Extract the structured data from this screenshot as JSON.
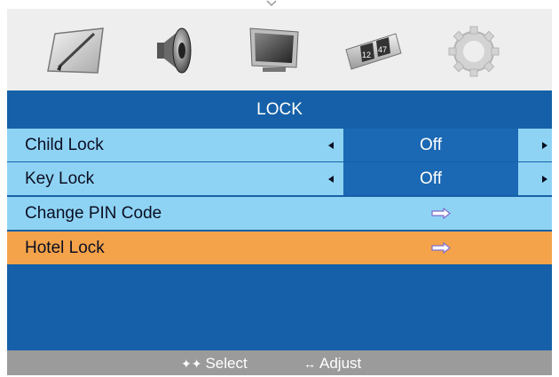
{
  "icons": [
    "picture-icon",
    "sound-icon",
    "screen-icon",
    "clock-icon",
    "settings-gear-icon"
  ],
  "clock_icon_text": {
    "hour": "12",
    "minute": "47"
  },
  "menu": {
    "title": "LOCK",
    "rows": [
      {
        "label": "Child Lock",
        "value": "Off"
      },
      {
        "label": "Key Lock",
        "value": "Off"
      },
      {
        "label": "Change PIN Code"
      },
      {
        "label": "Hotel Lock"
      }
    ]
  },
  "footer": {
    "select_symbol": "✦✦",
    "select_label": "Select",
    "adjust_symbol": "↔",
    "adjust_label": "Adjust"
  },
  "colors": {
    "panel": "#1560a8",
    "row": "#8fd3f4",
    "highlight": "#f5a34a",
    "value_box": "#1b68b4",
    "footer": "#9b9b9b",
    "icon_bar": "#eeeeee"
  }
}
